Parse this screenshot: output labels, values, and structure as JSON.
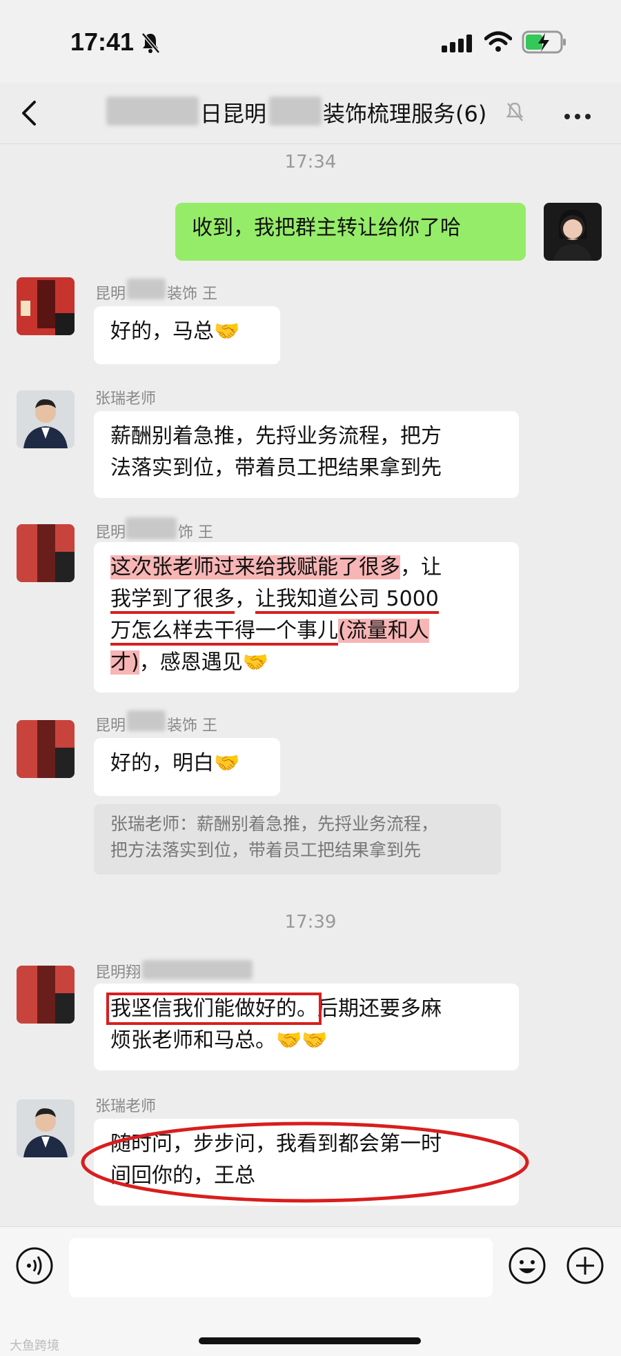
{
  "status": {
    "time": "17:41"
  },
  "header": {
    "title_a": "日昆明",
    "title_b": "装饰梳理服务(6)"
  },
  "timestamps": [
    "17:34",
    "17:39"
  ],
  "messages": {
    "m1": {
      "text": "收到，我把群主转让给你了哈"
    },
    "m2": {
      "sender": "昆明",
      "sender_tail": "装饰 王",
      "text": "好的，马总🤝"
    },
    "m3": {
      "sender": "张瑞老师",
      "line1": "薪酬别着急推，先捋业务流程，把方",
      "line2": "法落实到位，带着员工把结果拿到先"
    },
    "m4": {
      "sender": "昆明",
      "sender_tail": "饰 王",
      "p1": "这次张老师过来给我赋能了很多",
      "p2": "，让",
      "p3": "我学到了很多",
      "p4": "，",
      "p5": "让我知道公司 5000",
      "p6": "万怎么样去干得一个事儿",
      "p7": "(流量和人",
      "p8": "才)",
      "p9": "，感恩遇见🤝"
    },
    "m5": {
      "sender": "昆明",
      "sender_tail": "装饰 王",
      "text": "好的，明白🤝",
      "quote_line1": "张瑞老师：薪酬别着急推，先捋业务流程，",
      "quote_line2": "把方法落实到位，带着员工把结果拿到先"
    },
    "m6": {
      "sender": "昆明翔",
      "p1": "我坚信我们能做好的。",
      "p2": "后期还要多麻",
      "p3": "烦张老师和马总。🤝🤝"
    },
    "m7": {
      "sender": "张瑞老师",
      "line1": "随时问，步步问，我看到都会第一时",
      "line2": "间回你的，王总"
    }
  },
  "footer": {
    "watermark": "大鱼跨境"
  },
  "icons": [
    "bell-muted-icon",
    "signal-icon",
    "wifi-icon",
    "battery-charging-icon",
    "back-chevron-icon",
    "mute-icon",
    "more-icon",
    "voice-icon",
    "emoji-icon",
    "plus-icon"
  ],
  "colors": {
    "my_bubble": "#95ec69",
    "highlight": "#f07878",
    "annotation": "#d81e1e"
  }
}
